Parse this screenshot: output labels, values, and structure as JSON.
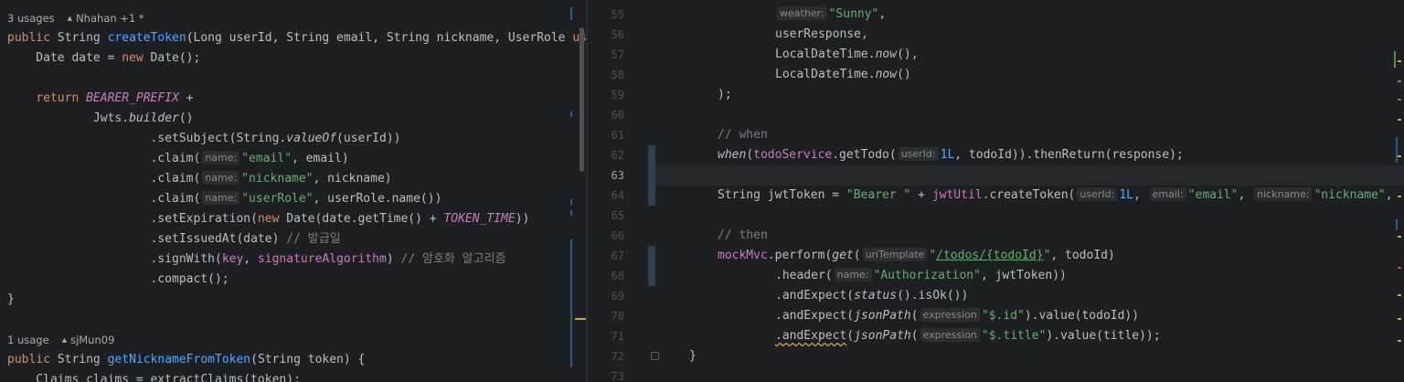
{
  "left": {
    "meta1": {
      "usages": "3 usages",
      "author": "Nhahan +1 *"
    },
    "meta2": {
      "usages": "1 usage",
      "author": "sjMun09"
    },
    "hints": {
      "name": "name:"
    },
    "comments": {
      "issued": "// 발급일",
      "sign": "// 암호화 알고리즘"
    }
  },
  "right": {
    "line_numbers": [
      "55",
      "56",
      "57",
      "58",
      "59",
      "60",
      "61",
      "62",
      "63",
      "64",
      "65",
      "66",
      "67",
      "68",
      "69",
      "70",
      "71",
      "72",
      "73"
    ],
    "hints": {
      "weather": "weather:",
      "userId": "userId:",
      "email": "email:",
      "nickname": "nickname:",
      "uriTemplate": "uriTemplate",
      "name": "name:",
      "expression": "expression"
    },
    "comments": {
      "when": "// when",
      "then": "// then"
    }
  },
  "colors": {
    "background": "#1e1f22",
    "keyword": "#cf8e6d",
    "function": "#56a8f5",
    "string": "#6aab73",
    "constant": "#c77dbb",
    "comment": "#7a7e85"
  }
}
